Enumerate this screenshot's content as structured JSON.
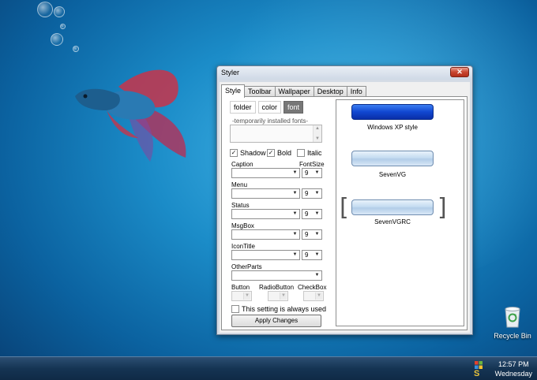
{
  "window": {
    "title": "Styler",
    "close_symbol": "✕"
  },
  "tabs": [
    "Style",
    "Toolbar",
    "Wallpaper",
    "Desktop",
    "Info"
  ],
  "subtabs": [
    "folder",
    "color",
    "font"
  ],
  "fonts_label": "-temporarily installed fonts-",
  "checkboxes": [
    {
      "label": "Shadow",
      "checked": true
    },
    {
      "label": "Bold",
      "checked": true
    },
    {
      "label": "Italic",
      "checked": false
    }
  ],
  "font_rows": [
    {
      "label": "Caption",
      "size": "9"
    },
    {
      "label": "Menu",
      "size": "9"
    },
    {
      "label": "Status",
      "size": "9"
    },
    {
      "label": "MsgBox",
      "size": "9"
    },
    {
      "label": "IconTitle",
      "size": "9"
    }
  ],
  "fontsize_header": "FontSize",
  "other_parts_label": "OtherParts",
  "small_combos": [
    "Button",
    "RadioButton",
    "CheckBox"
  ],
  "always_used_label": "This setting is always used",
  "apply_label": "Apply Changes",
  "previews": [
    "Windows XP style",
    "SevenVG",
    "SevenVGRC"
  ],
  "desktop": {
    "recycle_bin_label": "Recycle Bin"
  },
  "taskbar": {
    "time": "12:57 PM",
    "day": "Wednesday"
  },
  "colors": {
    "xp_blue": "#1147d1",
    "close_red": "#c7452f",
    "selected_tab": "#777777"
  }
}
